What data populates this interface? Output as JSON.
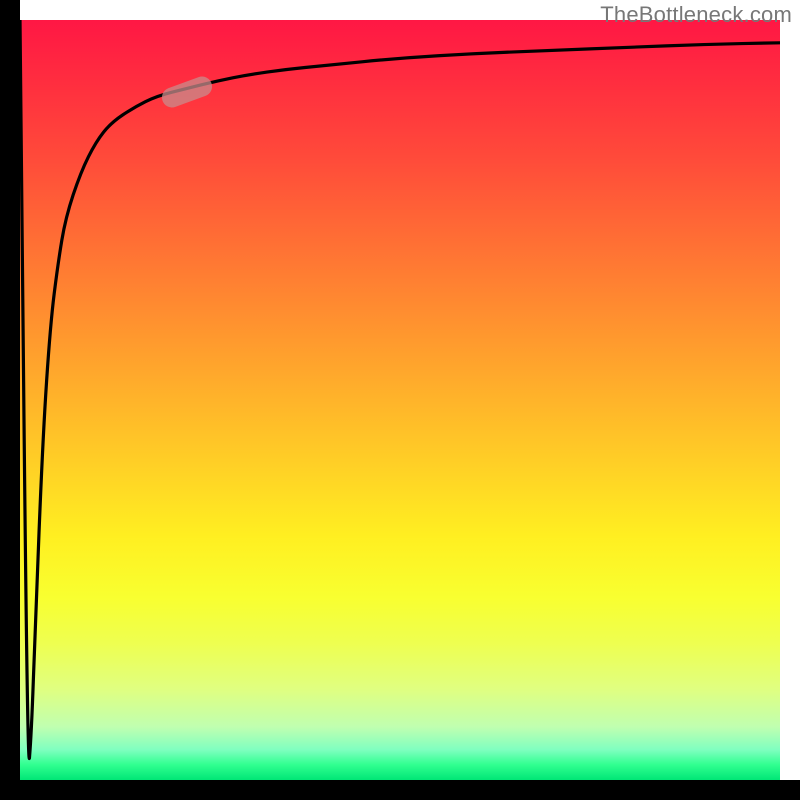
{
  "watermark": "TheBottleneck.com",
  "colors": {
    "axis": "#000000",
    "curve": "#000000",
    "marker": "rgba(200,140,140,0.75)"
  },
  "chart_data": {
    "type": "line",
    "title": "",
    "xlabel": "",
    "ylabel": "",
    "xlim": [
      0,
      100
    ],
    "ylim": [
      0,
      100
    ],
    "grid": false,
    "series": [
      {
        "name": "curve",
        "x": [
          0,
          1,
          1.5,
          2,
          3,
          4,
          5,
          6,
          8,
          10,
          12,
          15,
          18,
          22,
          26,
          30,
          35,
          40,
          50,
          60,
          70,
          80,
          90,
          100
        ],
        "y": [
          100,
          0,
          6,
          20,
          45,
          60,
          68,
          74,
          80,
          84,
          86.5,
          88.5,
          90,
          91,
          92,
          92.8,
          93.5,
          94,
          95,
          95.6,
          96,
          96.4,
          96.8,
          97
        ]
      }
    ],
    "marker": {
      "x": 22,
      "y": 90.5,
      "angle_deg": -20
    }
  }
}
